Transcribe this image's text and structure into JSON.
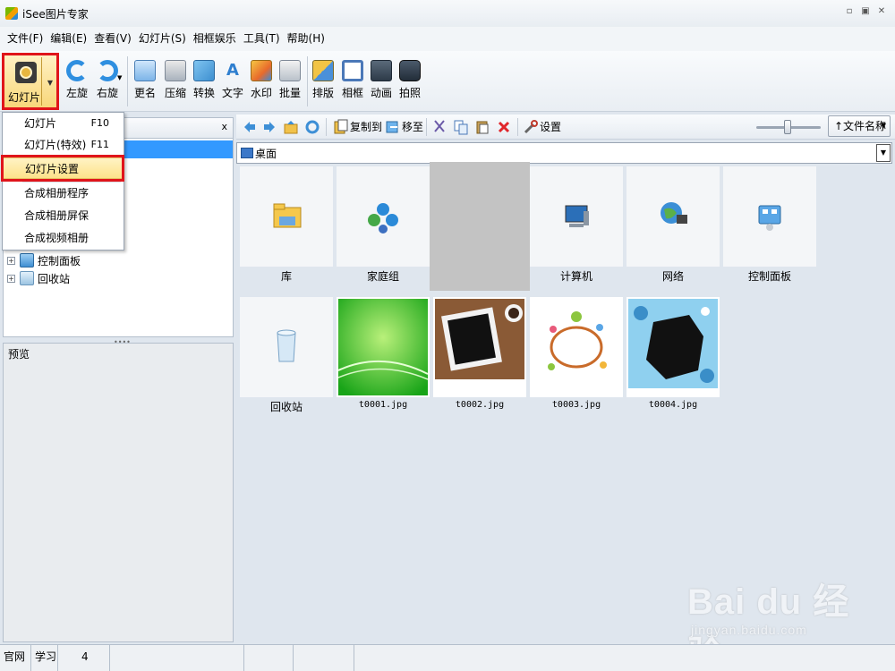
{
  "window": {
    "title": "iSee图片专家",
    "controls": [
      "▫",
      "▣",
      "✕"
    ]
  },
  "menubar": [
    "文件(F)",
    "编辑(E)",
    "查看(V)",
    "幻灯片(S)",
    "相框娱乐",
    "工具(T)",
    "帮助(H)"
  ],
  "toolbar": {
    "slideshow": "幻灯片",
    "rotate_left": "左旋",
    "rotate_right": "右旋",
    "rename": "更名",
    "compress": "压缩",
    "convert": "转换",
    "text": "文字",
    "watermark": "水印",
    "batch": "批量",
    "layout": "排版",
    "frame": "相框",
    "animation": "动画",
    "photo": "拍照"
  },
  "dropdown": {
    "items": [
      {
        "label": "幻灯片",
        "shortcut": "F10"
      },
      {
        "label": "幻灯片(特效)",
        "shortcut": "F11"
      },
      {
        "label": "幻灯片设置",
        "shortcut": ""
      },
      {
        "label": "合成相册程序",
        "shortcut": ""
      },
      {
        "label": "合成相册屏保",
        "shortcut": ""
      },
      {
        "label": "合成视频相册",
        "shortcut": ""
      }
    ],
    "highlighted_index": 2
  },
  "left_panel": {
    "close": "x",
    "tree": [
      {
        "label": "控制面板",
        "icon": "control-panel-icon"
      },
      {
        "label": "回收站",
        "icon": "recycle-bin-icon"
      }
    ],
    "preview_title": "预览"
  },
  "right_toolbar": {
    "copy_to": "复制到",
    "move_to": "移至",
    "settings": "设置",
    "sort": "↑文件名称"
  },
  "path": {
    "current": "桌面"
  },
  "items": [
    {
      "name": "库",
      "kind": "folder"
    },
    {
      "name": "家庭组",
      "kind": "homegroup"
    },
    {
      "name": "",
      "kind": "blank"
    },
    {
      "name": "计算机",
      "kind": "computer"
    },
    {
      "name": "网络",
      "kind": "network"
    },
    {
      "name": "控制面板",
      "kind": "control-panel"
    },
    {
      "name": "回收站",
      "kind": "recycle-bin"
    },
    {
      "name": "t0001.jpg",
      "kind": "image-green"
    },
    {
      "name": "t0002.jpg",
      "kind": "image-tablet"
    },
    {
      "name": "t0003.jpg",
      "kind": "image-frame"
    },
    {
      "name": "t0004.jpg",
      "kind": "image-blue-frame"
    }
  ],
  "statusbar": [
    "官网",
    "学习",
    "4",
    "",
    "",
    "",
    ""
  ],
  "watermark": {
    "brand": "Bai du 经验",
    "url": "jingyan.baidu.com"
  },
  "colors": {
    "highlight_red": "#e0141b",
    "selection_blue": "#3399ff",
    "menu_hover": "#fde28a"
  }
}
